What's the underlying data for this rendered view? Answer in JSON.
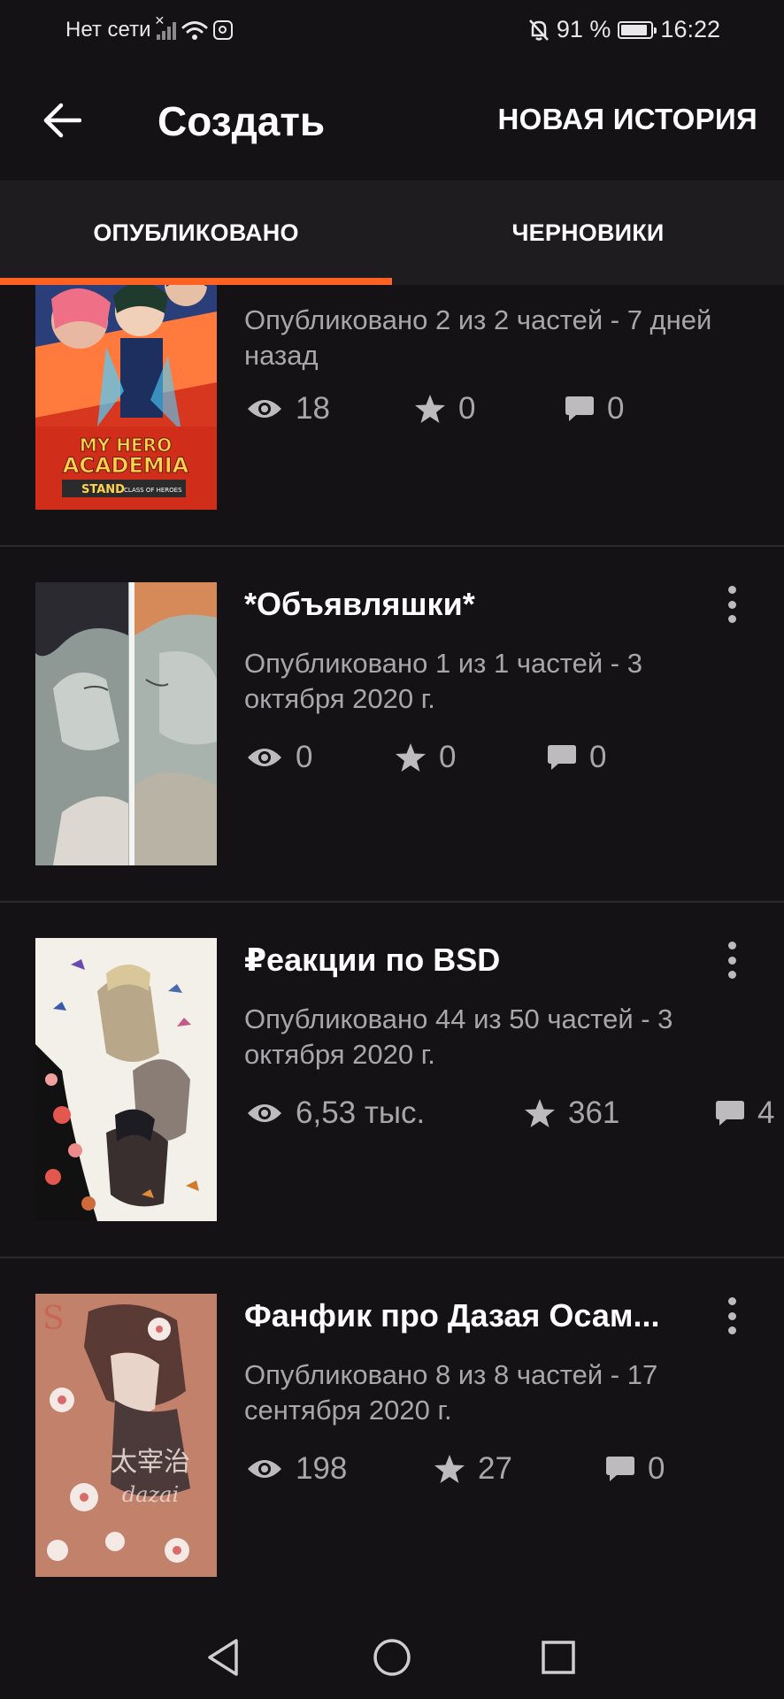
{
  "status_bar": {
    "carrier": "Нет сети",
    "battery": "91 %",
    "time": "16:22"
  },
  "app_bar": {
    "title": "Создать",
    "new_story": "НОВАЯ ИСТОРИЯ"
  },
  "tabs": [
    {
      "label": "ОПУБЛИКОВАНО",
      "active": true
    },
    {
      "label": "ЧЕРНОВИКИ",
      "active": false
    }
  ],
  "stories": [
    {
      "title": "",
      "meta": "Опубликовано 2 из 2 частей - 7 дней назад",
      "views": "18",
      "votes": "0",
      "comments": "0",
      "cover": {
        "text1": "MY HERO",
        "text2": "ACADEMIA",
        "text3": "STAND",
        "text4": "THE ULTIMATE CLASS OF HEROES",
        "bg": "#c8321e"
      }
    },
    {
      "title": "*Объявляшки*",
      "meta": "Опубликовано 1 из 1 частей - 3 октября 2020 г.",
      "views": "0",
      "votes": "0",
      "comments": "0",
      "cover": {
        "bg": "#9da7a0"
      }
    },
    {
      "title": "₽еакции по BSD",
      "meta": "Опубликовано 44 из 50 частей - 3 октября 2020 г.",
      "views": "6,53 тыс.",
      "votes": "361",
      "comments": "4",
      "cover": {
        "bg": "#f2efe9"
      }
    },
    {
      "title": "Фанфик про Дазая Осам...",
      "meta": "Опубликовано 8 из 8 частей - 17 сентября 2020 г.",
      "views": "198",
      "votes": "27",
      "comments": "0",
      "cover": {
        "text1": "太宰治",
        "text2": "dazai",
        "bg": "#b5715e"
      }
    }
  ],
  "colors": {
    "accent": "#ff6122",
    "background": "#141215",
    "tab_bar": "#1e1c1f",
    "muted_text": "#a8a6a9"
  },
  "icons": [
    "back-arrow-icon",
    "eye-icon",
    "star-icon",
    "comment-icon",
    "more-vert-icon",
    "nav-back-icon",
    "nav-home-icon",
    "nav-recents-icon"
  ]
}
